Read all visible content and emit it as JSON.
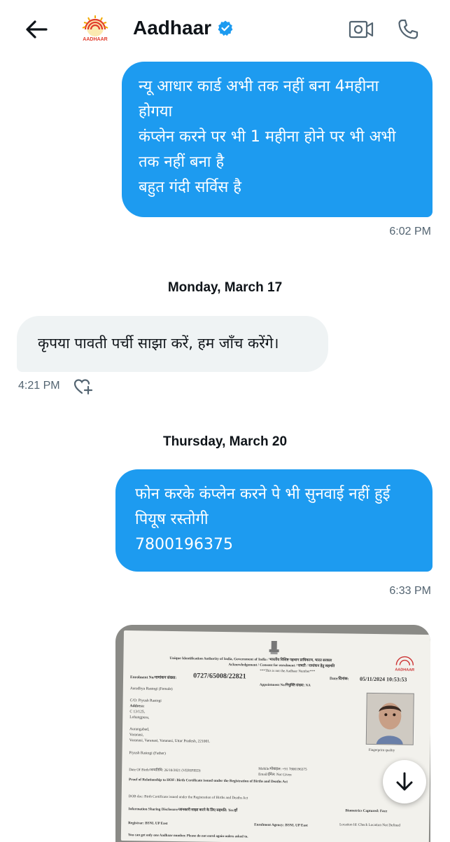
{
  "header": {
    "title": "Aadhaar",
    "logo_text": "AADHAAR",
    "icons": {
      "back": "back-arrow-icon",
      "verified": "verified-badge-icon",
      "video": "video-call-icon",
      "call": "phone-icon"
    },
    "colors": {
      "verified": "#1d9bf0"
    }
  },
  "messages": [
    {
      "direction": "outgoing",
      "lines": [
        "न्यू आधार कार्ड अभी तक नहीं बना 4महीना",
        "होगया",
        "कंप्लेन करने पर भी 1 महीना होने पर भी अभी",
        "तक नहीं बना है",
        "बहुत गंदी सर्विस है"
      ],
      "time": "6:02 PM"
    },
    {
      "divider": "Monday, March 17"
    },
    {
      "direction": "incoming",
      "lines": [
        "कृपया पावती पर्ची साझा करें, हम जाँच करेंगे।"
      ],
      "time": "4:21 PM",
      "reaction_icon": "add-reaction-heart-icon"
    },
    {
      "divider": "Thursday, March 20"
    },
    {
      "direction": "outgoing",
      "lines": [
        "फोन करके कंप्लेन करने पे भी सुनवाई नहीं हुई",
        "पियूष रस्तोगी",
        "7800196375"
      ],
      "time": "6:33 PM"
    }
  ],
  "attachment": {
    "heading": "Unique Identification Authority of India, Government of India / भारतीय विशिष्ट पहचान प्राधिकरण, भारत सरकार",
    "subheading": "Acknowledgement / Consent for enrolment / पावती / नामांकन हेतु सहमति",
    "not_aadhaar": "***This is not the Aadhaar Number***",
    "enrolment_label": "Enrolment No/नामांकन संख्या:",
    "enrolment_no": "0727/65008/22821",
    "date_label": "Date/दिनांक:",
    "date": "05/11/2024 10:53:53",
    "appointment": "Appointment No/नियुक्ति संख्या: NA",
    "name": "Aaradhya Rastogi (Female)",
    "co": "C/O: Piyush Rastogi",
    "address_label": "Address:",
    "address_lines": [
      "C 13/125,",
      "Lohangpura,",
      "Aurangabad,",
      "Varanasi,",
      "Varanasi, Varanasi, Varanasi, Uttar Pradesh, 221001."
    ],
    "father": "Piyush Rastogi (Father)",
    "dob": "Date Of Birth/जन्मतिथि: 26/10/2021 (VERIFIED)",
    "mobile": "Mobile/मोबाइल: +91 7800196375",
    "email": "Email/ईमेल: Not Given",
    "fingerprint": "Fingerprint quality",
    "proof": "Proof of Relationship to HOF: Birth Certificate issued under the Registration of Births and Deaths Act",
    "dob_doc": "DOB doc: Birth Certificate issued under the Registration of Births and Deaths Act",
    "info_sharing": "Information Sharing Disclosure/जानकारी साझा करने के लिए सहमति: Yes/हाँ",
    "biometrics": "Biometrics Captured: Face",
    "registrar": "Registrar: BSNL UP East",
    "agency": "Enrolment Agency: BSNL UP East",
    "location": "Location Id: Check Location Not Defined",
    "footer": "You can get only one Aadhaar number. Please do not enrol again unless asked to.",
    "brand": "AADHAAR"
  },
  "scroll_icon": "arrow-down-icon"
}
